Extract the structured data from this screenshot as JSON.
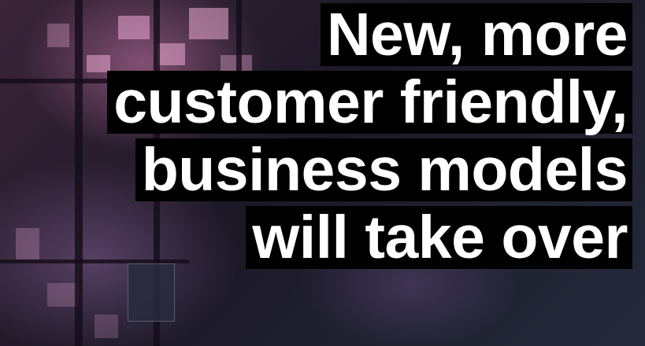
{
  "headline": {
    "lines": [
      "New, more",
      "customer friendly,",
      "business models",
      "will take over"
    ]
  },
  "colors": {
    "text": "#ffffff",
    "highlight": "#000000",
    "background_tint": "#c878aa"
  }
}
